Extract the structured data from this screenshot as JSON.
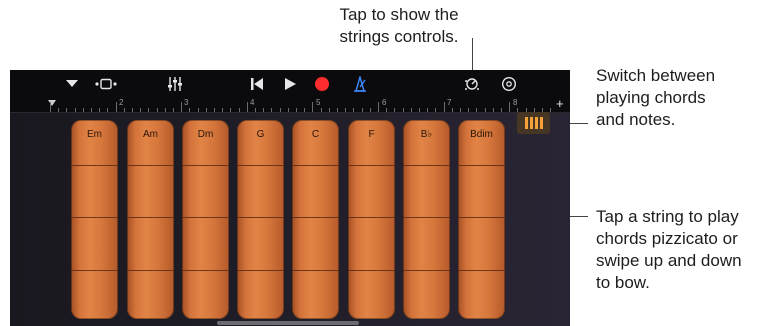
{
  "callouts": {
    "strings_controls": [
      "Tap to show the",
      "strings controls."
    ],
    "chords_notes": [
      "Switch between",
      "playing chords",
      "and notes."
    ],
    "play_string": [
      "Tap a string to play",
      "chords pizzicato or",
      "swipe up and down",
      "to bow."
    ]
  },
  "ruler": {
    "bar_numbers": [
      "2",
      "3",
      "4",
      "5",
      "6",
      "7",
      "8"
    ],
    "add_symbol": "+"
  },
  "chord_strips": [
    {
      "label": "Em"
    },
    {
      "label": "Am"
    },
    {
      "label": "Dm"
    },
    {
      "label": "G"
    },
    {
      "label": "C"
    },
    {
      "label": "F"
    },
    {
      "label": "B♭"
    },
    {
      "label": "Bdim"
    }
  ],
  "colors": {
    "record": "#ff2d2d",
    "metronome": "#3d8cff",
    "strip_wood": "#d6773c",
    "selector_active": "#f6a13a"
  },
  "icons": [
    "chevron-down-icon",
    "tracks-view-icon",
    "mixer-icon",
    "go-to-start-icon",
    "play-icon",
    "record-icon",
    "metronome-icon",
    "strings-controls-knob-icon",
    "settings-gear-icon",
    "chords-notes-switch-icon"
  ]
}
